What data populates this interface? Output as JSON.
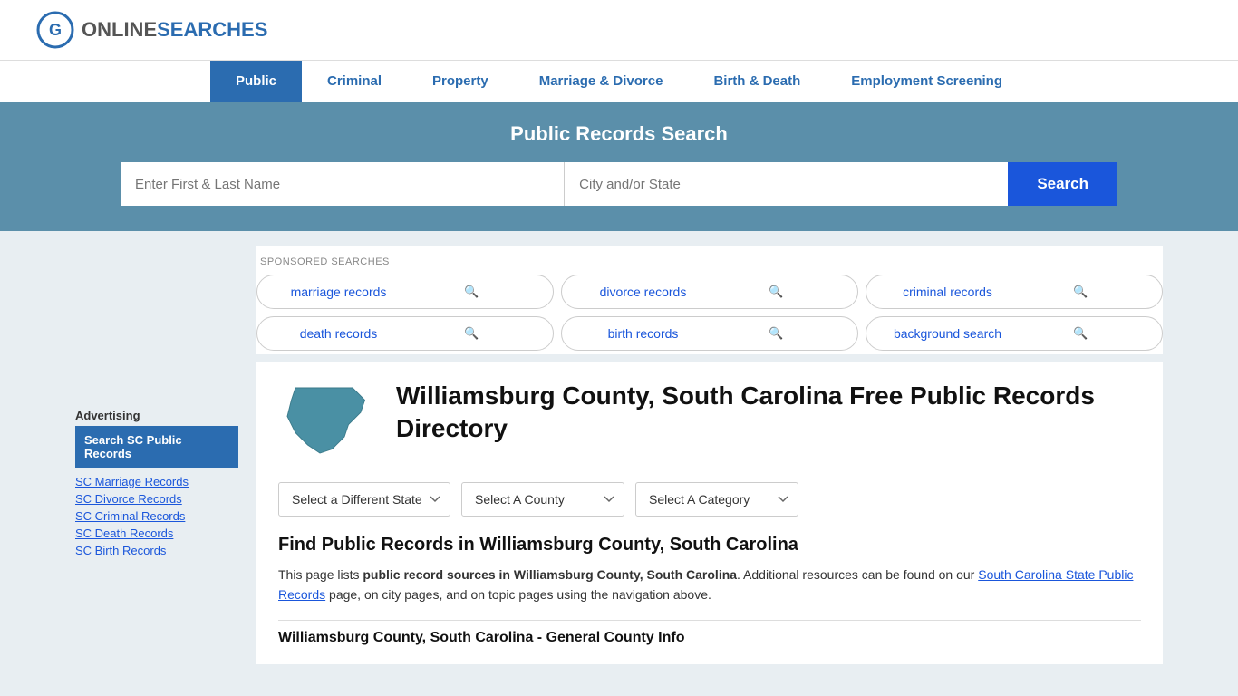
{
  "header": {
    "logo_online": "ONLINE",
    "logo_searches": "SEARCHES",
    "logo_aria": "OnlineSearches"
  },
  "nav": {
    "items": [
      {
        "label": "Public",
        "active": true
      },
      {
        "label": "Criminal",
        "active": false
      },
      {
        "label": "Property",
        "active": false
      },
      {
        "label": "Marriage & Divorce",
        "active": false
      },
      {
        "label": "Birth & Death",
        "active": false
      },
      {
        "label": "Employment Screening",
        "active": false
      }
    ]
  },
  "search_banner": {
    "title": "Public Records Search",
    "name_placeholder": "Enter First & Last Name",
    "city_placeholder": "City and/or State",
    "button_label": "Search"
  },
  "sponsored": {
    "label": "SPONSORED SEARCHES",
    "items": [
      "marriage records",
      "divorce records",
      "criminal records",
      "death records",
      "birth records",
      "background search"
    ]
  },
  "directory": {
    "title": "Williamsburg County, South Carolina Free Public Records Directory",
    "dropdown_state": "Select a Different State",
    "dropdown_county": "Select A County",
    "dropdown_category": "Select A Category",
    "find_title": "Find Public Records in Williamsburg County, South Carolina",
    "find_text_1": "This page lists ",
    "find_text_bold": "public record sources in Williamsburg County, South Carolina",
    "find_text_2": ". Additional resources can be found on our ",
    "find_link": "South Carolina State Public Records",
    "find_text_3": " page, on city pages, and on topic pages using the navigation above.",
    "general_info_title": "Williamsburg County, South Carolina - General County Info"
  },
  "sidebar": {
    "ad_label": "Advertising",
    "ad_box": "Search SC Public Records",
    "links": [
      "SC Marriage Records",
      "SC Divorce Records",
      "SC Criminal Records",
      "SC Death Records",
      "SC Birth Records"
    ]
  }
}
